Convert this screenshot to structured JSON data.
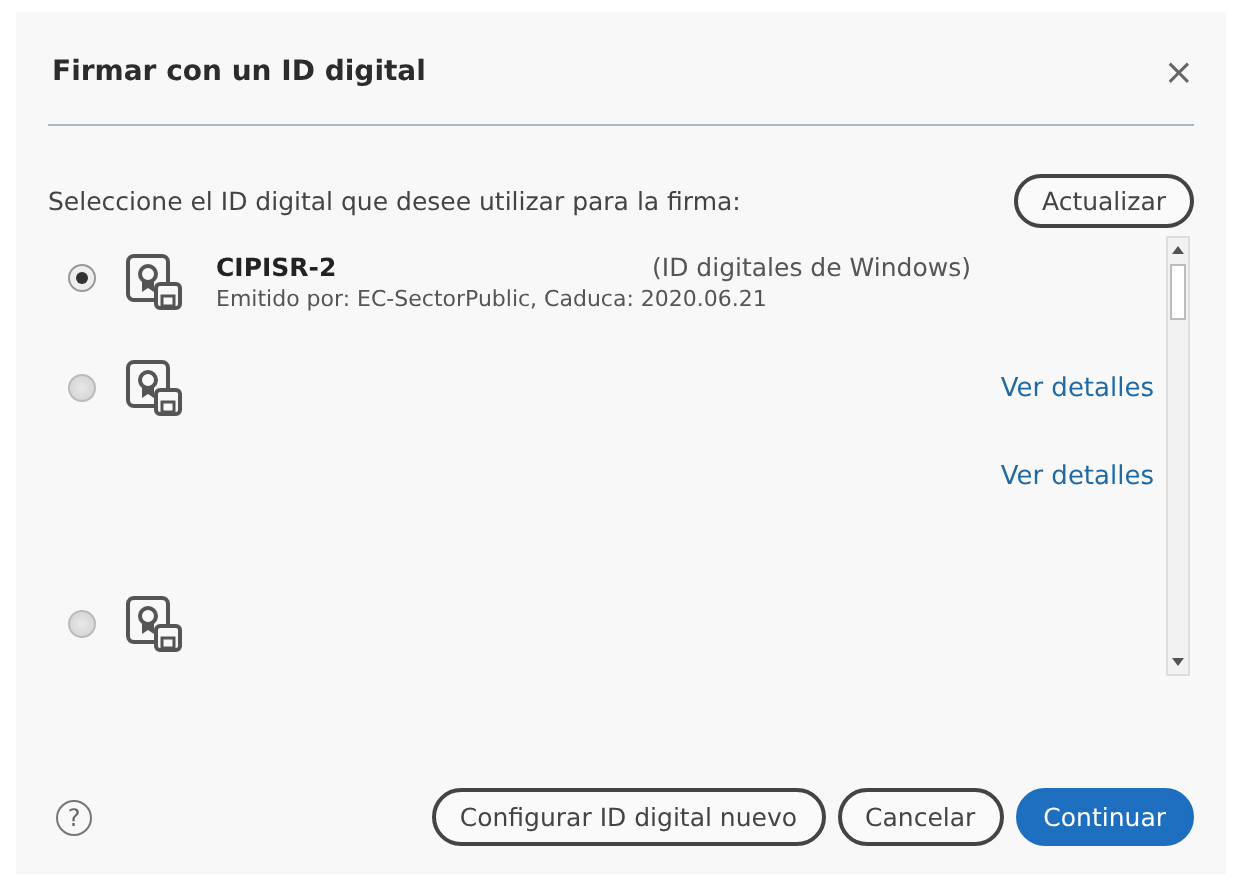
{
  "dialog": {
    "title": "Firmar con un ID digital",
    "close": "×"
  },
  "prompt": "Seleccione el ID digital que desee utilizar para la firma:",
  "refresh_button": "Actualizar",
  "ids": [
    {
      "kind": "certificate",
      "selected": true,
      "name": "CIPISR-2",
      "store": "(ID digitales de Windows)",
      "issuer": "Emitido por: EC-SectorPublic, Caduca: 2020.06.21"
    },
    {
      "kind": "certificate",
      "selected": false,
      "link": "Ver detalles"
    },
    {
      "kind": "details",
      "link": "Ver detalles"
    },
    {
      "kind": "certificate",
      "selected": false
    }
  ],
  "help": "?",
  "buttons": [
    {
      "label": "Configurar ID digital nuevo",
      "kind": "secondary"
    },
    {
      "label": "Cancelar",
      "kind": "secondary"
    },
    {
      "label": "Continuar",
      "kind": "primary"
    }
  ]
}
